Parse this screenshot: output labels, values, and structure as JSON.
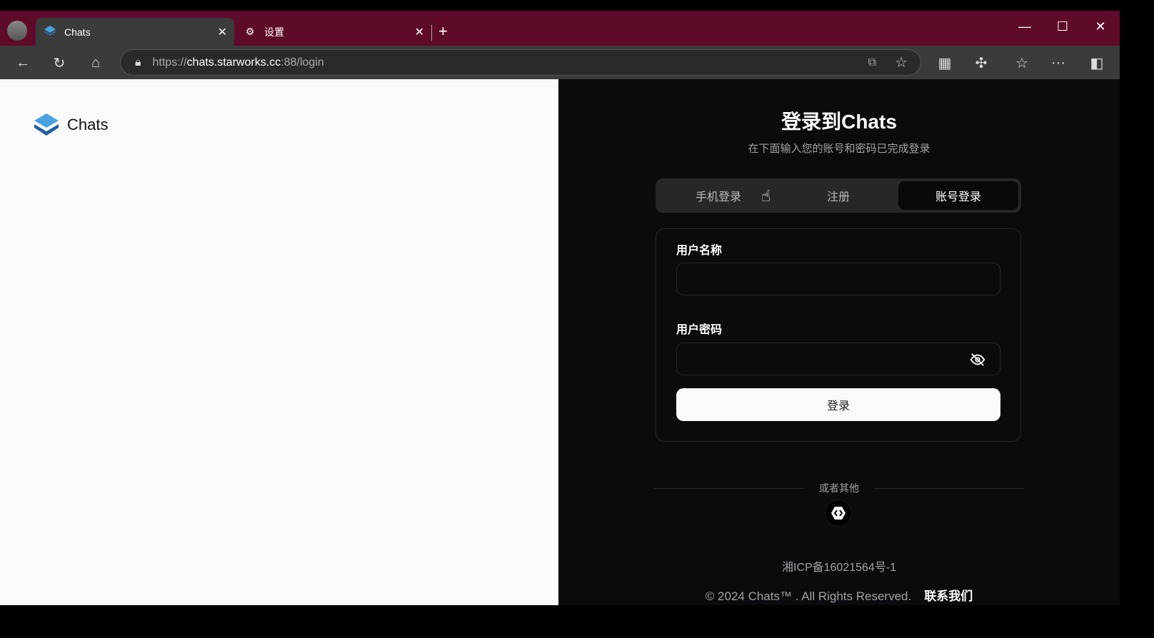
{
  "browser": {
    "tabs": [
      {
        "label": "Chats",
        "active": true
      },
      {
        "label": "设置",
        "active": false
      }
    ],
    "url": {
      "scheme": "https://",
      "host": "chats.starworks.cc",
      "rest": ":88/login"
    }
  },
  "left": {
    "brand": "Chats"
  },
  "login": {
    "title": "登录到Chats",
    "subtitle": "在下面输入您的账号和密码已完成登录",
    "tabs": [
      {
        "label": "手机登录"
      },
      {
        "label": "注册"
      },
      {
        "label": "账号登录",
        "active": true
      }
    ],
    "username_label": "用户名称",
    "username_value": "",
    "password_label": "用户密码",
    "password_value": "",
    "submit": "登录",
    "divider": "或者其他"
  },
  "footer": {
    "icp": "湘ICP备16021564号-1",
    "copyright": "© 2024 Chats™ . All Rights Reserved.",
    "contact": "联系我们"
  }
}
